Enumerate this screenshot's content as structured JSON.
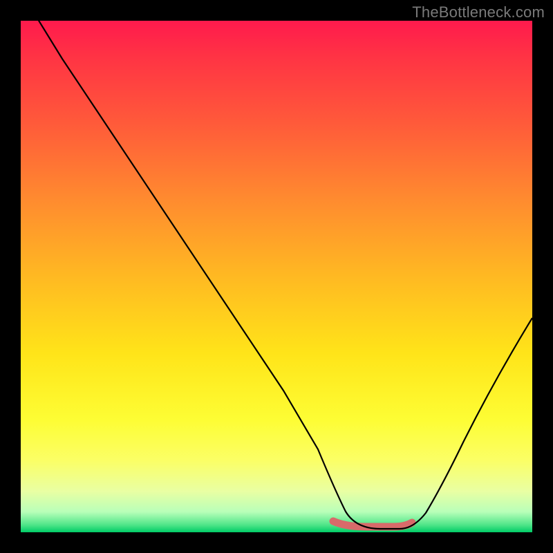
{
  "watermark": {
    "text": "TheBottleneck.com"
  },
  "chart_data": {
    "type": "line",
    "title": "",
    "xlabel": "",
    "ylabel": "",
    "ylim": [
      0,
      100
    ],
    "xlim": [
      0,
      100
    ],
    "series": [
      {
        "name": "bottleneck-curve",
        "x": [
          0,
          10,
          20,
          30,
          40,
          50,
          58,
          62,
          66,
          70,
          74,
          78,
          85,
          92,
          100
        ],
        "values": [
          100,
          85,
          70,
          55,
          40,
          25,
          12,
          6,
          2,
          0,
          0,
          2,
          9,
          20,
          38
        ]
      }
    ],
    "optimal_range": {
      "x_start": 62,
      "x_end": 76,
      "value": 0
    },
    "background_gradient": {
      "top": "#ff1a4d",
      "mid": "#ffe419",
      "bottom": "#00cc66"
    }
  }
}
